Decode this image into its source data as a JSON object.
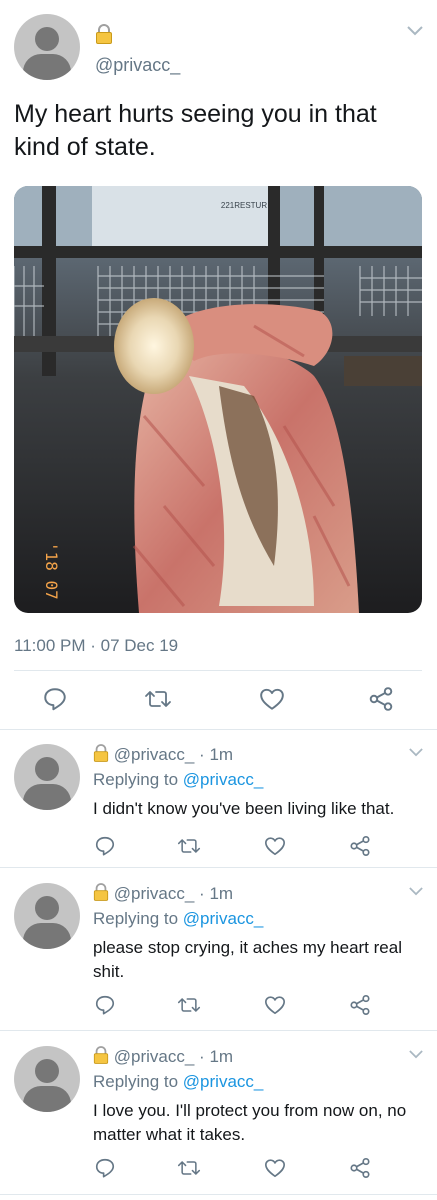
{
  "main_tweet": {
    "handle": "@privacc_",
    "text": "My heart hurts seeing you in that kind of state.",
    "photo_overlay_text": "'18 07",
    "photo_sign_text": "221RESTUR",
    "timestamp": "11:00 PM · 07 Dec 19"
  },
  "replies": [
    {
      "handle": "@privacc_",
      "separator": "·",
      "time": "1m",
      "replying_prefix": "Replying to",
      "replying_to": "@privacc_",
      "text": "I didn't know you've been living like that."
    },
    {
      "handle": "@privacc_",
      "separator": "·",
      "time": "1m",
      "replying_prefix": "Replying to",
      "replying_to": "@privacc_",
      "text": "please stop crying, it aches my heart real shit."
    },
    {
      "handle": "@privacc_",
      "separator": "·",
      "time": "1m",
      "replying_prefix": "Replying to",
      "replying_to": "@privacc_",
      "text": "I love you. I'll protect you from now on, no matter what it takes."
    }
  ],
  "icons": {
    "reply": "reply-icon",
    "retweet": "retweet-icon",
    "like": "heart-icon",
    "share": "share-icon",
    "lock": "lock-icon",
    "more": "chevron-down-icon"
  },
  "colors": {
    "handle": "#657786",
    "link": "#1b95e0",
    "icon": "#657786",
    "lock": "#f5c542",
    "divider": "#e1e8ed"
  }
}
